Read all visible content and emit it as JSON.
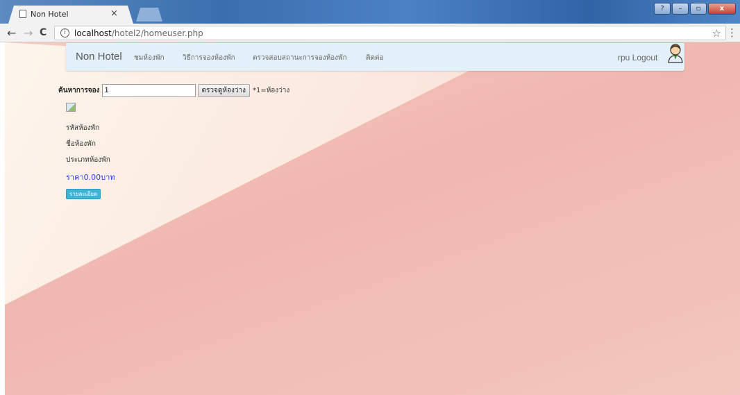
{
  "browser": {
    "tab_title": "Non Hotel",
    "tab_close": "×",
    "url_host": "localhost",
    "url_path": "/hotel2/homeuser.php",
    "back": "←",
    "forward": "→",
    "reload": "C",
    "info": "i",
    "bookmark": "☆",
    "menu": "⋮",
    "window_buttons": [
      "?",
      "–",
      "▫",
      "x"
    ]
  },
  "navbar": {
    "brand": "Non Hotel",
    "links": [
      "ชมห้องพัก",
      "วิธีการจองห้องพัก",
      "ตรวจสอบสถานะการจองห้องพัก",
      "ติดต่อ"
    ],
    "user_logout": "rpu Logout"
  },
  "search": {
    "label": "ค้นหาการจอง",
    "value": "1",
    "button": "ตรวจดูห้องว่าง",
    "note": "*1=ห้องว่าง"
  },
  "room": {
    "code_label": "รหัสห้องพัก",
    "name_label": "ชื่อห้องพัก",
    "type_label": "ประเภทห้องพัก",
    "price": "ราคา0.00บาท",
    "details_button": "รายละเอียด"
  },
  "colors": {
    "navbar_bg": "#e3f0fa",
    "price": "#2b3cf0",
    "details_button": "#3fb3d6"
  }
}
